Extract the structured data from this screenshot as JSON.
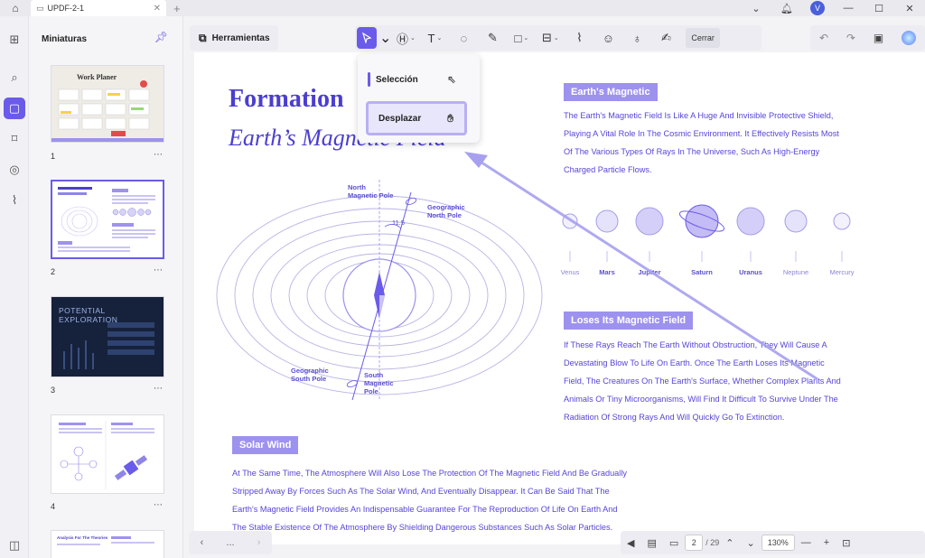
{
  "titlebar": {
    "tab_title": "UPDF-2-1",
    "avatar_letter": "V"
  },
  "thumbnails": {
    "heading": "Miniaturas",
    "pages": [
      {
        "num": "1",
        "title": "Work Planer"
      },
      {
        "num": "2",
        "title": "Formation Of The Earth's Magnetic Field"
      },
      {
        "num": "3",
        "title": "POTENTIAL EXPLORATION"
      },
      {
        "num": "4"
      },
      {
        "num": "",
        "title": "Analysis For The Theories"
      }
    ]
  },
  "toolbar": {
    "tools_label": "Herramientas",
    "close_label": "Cerrar"
  },
  "dropdown": {
    "select_label": "Selección",
    "pan_label": "Desplazar"
  },
  "document": {
    "title_line1": "Formation",
    "title_line2": "Earth’s Magnetic Field",
    "section1": {
      "heading": "Earth's Magnetic",
      "lines": [
        "The Earth's Magnetic Field Is Like A Huge And Invisible Protective Shield,",
        "Playing A Vital Role In The Cosmic Environment. It Effectively Resists Most",
        "Of The Various Types Of Rays In The Universe, Such As High-Energy",
        "Charged Particle Flows."
      ]
    },
    "planets": [
      "Venus",
      "Mars",
      "Jupiter",
      "Saturn",
      "Uranus",
      "Neptune",
      "Mercury"
    ],
    "section2": {
      "heading": "Loses Its Magnetic Field",
      "lines": [
        "If These Rays Reach The Earth Without Obstruction, They Will Cause A",
        "Devastating Blow To Life On Earth. Once The Earth Loses Its Magnetic",
        "Field, The Creatures On The Earth's Surface, Whether Complex Plants And",
        "Animals Or Tiny Microorganisms, Will Find It Difficult To Survive Under The",
        "Radiation Of Strong Rays And Will Quickly Go To Extinction."
      ]
    },
    "section3": {
      "heading": "Solar Wind",
      "lines": [
        "At The Same Time, The Atmosphere Will Also Lose The Protection Of The Magnetic Field And Be Gradually",
        "Stripped Away By Forces Such As The Solar Wind, And Eventually Disappear. It Can Be Said That The",
        "Earth's Magnetic Field Provides An Indispensable Guarantee For The Reproduction Of Life On Earth And",
        "The Stable Existence Of The Atmosphere By Shielding Dangerous Substances Such As Solar Particles."
      ]
    },
    "diagram": {
      "north_magnetic": [
        "North",
        "Magnetic Pole"
      ],
      "geo_north": [
        "Geographic",
        "North Pole"
      ],
      "geo_south": [
        "Geographic",
        "South Pole"
      ],
      "south_magnetic": [
        "South",
        "Magnetic",
        "Pole"
      ],
      "angle": "11.5"
    }
  },
  "bottombar": {
    "more": "...",
    "page_current": "2",
    "page_total": "/ 29",
    "zoom": "130%"
  },
  "colors": {
    "accent": "#6a5bea",
    "doc_text": "#5645d8",
    "pill": "#9d92ee"
  }
}
